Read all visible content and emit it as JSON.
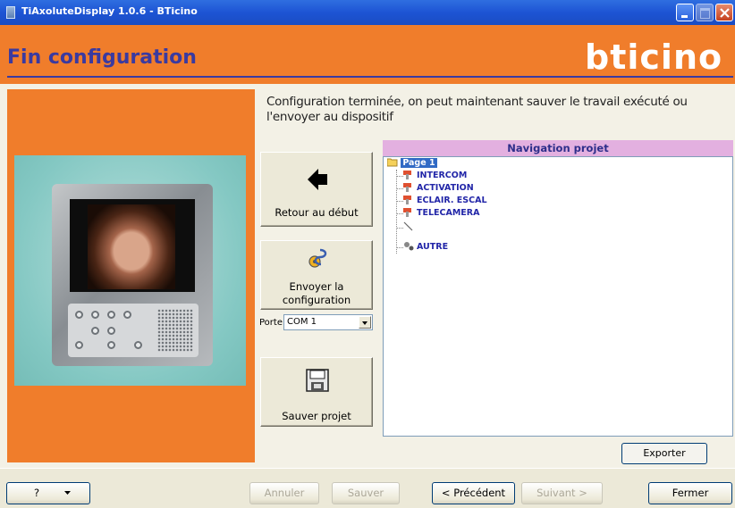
{
  "window": {
    "title": "TiAxoluteDisplay 1.0.6 - BTicino"
  },
  "header": {
    "page_title": "Fin configuration",
    "logo": "bticino"
  },
  "main": {
    "description": "Configuration terminée, on peut maintenant sauver le travail exécuté ou l'envoyer au dispositif",
    "buttons": {
      "back": "Retour au début",
      "send_line1": "Envoyer la",
      "send_line2": "configuration",
      "save_project": "Sauver projet"
    },
    "port": {
      "label": "Porte:",
      "value": "COM 1"
    },
    "navigation": {
      "title": "Navigation projet",
      "root": "Page 1",
      "items": [
        "INTERCOM",
        "ACTIVATION",
        "ECLAIR. ESCAL",
        "TELECAMERA",
        "AUTRE"
      ]
    },
    "export_label": "Exporter"
  },
  "footer": {
    "help": "?",
    "cancel": "Annuler",
    "save": "Sauver",
    "previous": "< Précédent",
    "next": "Suivant >",
    "close": "Fermer"
  }
}
